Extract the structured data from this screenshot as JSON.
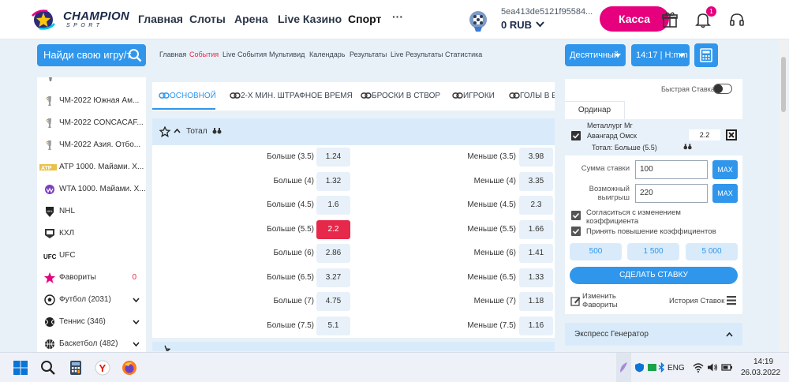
{
  "header": {
    "logo_text": "CHAMPION",
    "logo_sub": "SPORT",
    "nav": [
      "Главная",
      "Слоты",
      "Арена",
      "Live Казино",
      "Спорт"
    ],
    "more": "···",
    "account_id": "5ea413de5121f95584...",
    "balance": "0 RUB",
    "cashier_label": "Касса",
    "notifications_count": "1"
  },
  "search": {
    "placeholder": "Найди свою игру/т"
  },
  "subnav": [
    "Главная",
    "События",
    "Live События",
    "Мультивид",
    "Календарь",
    "Результаты",
    "Live Результаты",
    "Статистика"
  ],
  "subnav_active_index": 1,
  "controls": {
    "odds_format": "Десятичный",
    "time_format": "14:17 | H:mm"
  },
  "sidebar": {
    "items": [
      {
        "label": "ЧМ-2022 Южная Ам...",
        "icon": "trophy-icon"
      },
      {
        "label": "ЧМ-2022 CONCACAF...",
        "icon": "trophy-icon"
      },
      {
        "label": "ЧМ-2022 Азия. Отбо...",
        "icon": "trophy-icon"
      },
      {
        "label": "ATP 1000. Майами. Х...",
        "icon": "atp-icon"
      },
      {
        "label": "WTA 1000. Майами. Х...",
        "icon": "wta-icon"
      },
      {
        "label": "NHL",
        "icon": "nhl-icon"
      },
      {
        "label": "КХЛ",
        "icon": "khl-icon"
      },
      {
        "label": "UFC",
        "icon": "ufc-icon"
      },
      {
        "label": "Фавориты",
        "icon": "star-icon",
        "count": "0"
      },
      {
        "label": "Футбол (2031)",
        "icon": "football-icon"
      },
      {
        "label": "Теннис (346)",
        "icon": "tennis-icon"
      },
      {
        "label": "Баскетбол (482)",
        "icon": "basketball-icon"
      }
    ]
  },
  "tabs": [
    "ОСНОВНОЙ",
    "2-Х МИН. ШТРАФНОЕ ВРЕМЯ",
    "БРОСКИ В СТВОР",
    "ИГРОКИ",
    "ГОЛЫ В Б"
  ],
  "market": {
    "title": "Тотал"
  },
  "odds_rows": [
    {
      "left_label": "Больше (3.5)",
      "left_odd": "1.24",
      "right_label": "Меньше (3.5)",
      "right_odd": "3.98"
    },
    {
      "left_label": "Больше (4)",
      "left_odd": "1.32",
      "right_label": "Меньше (4)",
      "right_odd": "3.35"
    },
    {
      "left_label": "Больше (4.5)",
      "left_odd": "1.6",
      "right_label": "Меньше (4.5)",
      "right_odd": "2.3"
    },
    {
      "left_label": "Больше (5.5)",
      "left_odd": "2.2",
      "right_label": "Меньше (5.5)",
      "right_odd": "1.66",
      "selected": true
    },
    {
      "left_label": "Больше (6)",
      "left_odd": "2.86",
      "right_label": "Меньше (6)",
      "right_odd": "1.41"
    },
    {
      "left_label": "Больше (6.5)",
      "left_odd": "3.27",
      "right_label": "Меньше (6.5)",
      "right_odd": "1.33"
    },
    {
      "left_label": "Больше (7)",
      "left_odd": "4.75",
      "right_label": "Меньше (7)",
      "right_odd": "1.18"
    },
    {
      "left_label": "Больше (7.5)",
      "left_odd": "5.1",
      "right_label": "Меньше (7.5)",
      "right_odd": "1.16"
    }
  ],
  "betslip": {
    "fast_bet_label": "Быстрая Ставка",
    "tab": "Ординар",
    "team1": "Металлург Мг",
    "team2": "Авангард Омск",
    "odd": "2.2",
    "selection": "Тотал: Больше (5.5)",
    "stake_label": "Сумма ставки",
    "stake_value": "100",
    "win_label_1": "Возможный",
    "win_label_2": "выигрыш",
    "win_value": "220",
    "max_label": "MAX",
    "accept_change_1": "Согласиться с изменением",
    "accept_change_2": "коэффициента",
    "accept_increase": "Принять повышение коэффициентов",
    "amounts": [
      "500",
      "1 500",
      "5 000"
    ],
    "make_bet": "СДЕЛАТЬ СТАВКУ",
    "edit_fav_1": "Изменить",
    "edit_fav_2": "Фавориты",
    "history": "История Ставок",
    "express": "Экспресс Генератор"
  },
  "taskbar": {
    "lang": "ENG",
    "time": "14:19",
    "date": "26.03.2022"
  },
  "colors": {
    "accent": "#2f96ec",
    "brand_pink": "#e6007e",
    "selected_odd": "#e6294b"
  }
}
